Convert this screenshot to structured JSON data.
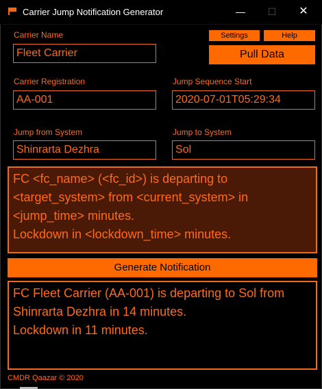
{
  "window": {
    "title": "Carrier Jump Notification Generator",
    "minimize_glyph": "—",
    "maximize_glyph": "☐",
    "close_glyph": "✕"
  },
  "colors": {
    "accent": "#ff6a00",
    "field_border": "#f26b1c",
    "text": "#ff6a1a",
    "template_bg": "#4a1a06",
    "background": "#000000"
  },
  "carrier_name": {
    "label": "Carrier Name",
    "value": "Fleet Carrier"
  },
  "buttons": {
    "settings": "Settings",
    "help": "Help",
    "pull_data": "Pull Data",
    "generate": "Generate Notification"
  },
  "carrier_registration": {
    "label": "Carrier Registration",
    "value": "AA-001"
  },
  "jump_sequence_start": {
    "label": "Jump Sequence Start",
    "value": "2020-07-01T05:29:34"
  },
  "jump_from": {
    "label": "Jump from System",
    "value": "Shinrarta Dezhra"
  },
  "jump_to": {
    "label": "Jump to System",
    "value": "Sol"
  },
  "template": {
    "lines": [
      "FC <fc_name> (<fc_id>) is departing to",
      "<target_system> from <current_system> in",
      "<jump_time> minutes.",
      "Lockdown in <lockdown_time> minutes."
    ]
  },
  "output": {
    "lines": [
      "FC Fleet Carrier (AA-001) is departing to Sol from",
      "Shinrarta Dezhra in 14 minutes.",
      "Lockdown in 11 minutes."
    ]
  },
  "footer": "CMDR Qaazar © 2020"
}
